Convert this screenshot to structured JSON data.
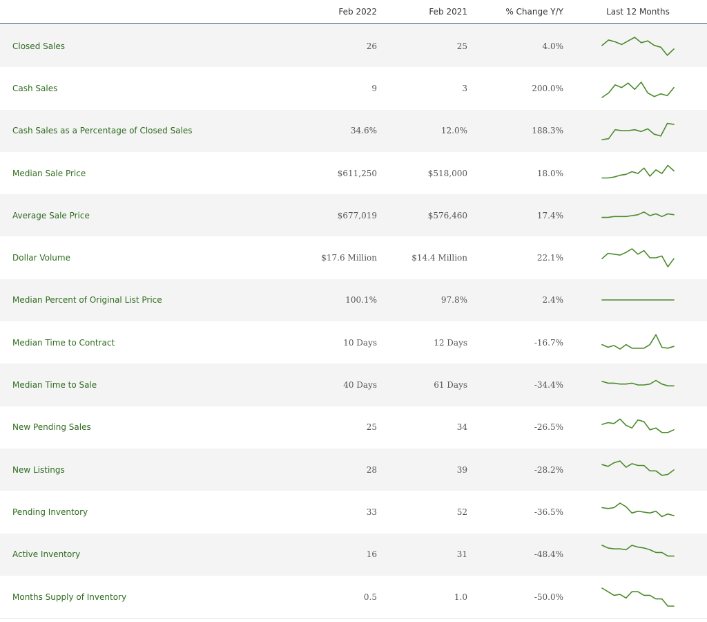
{
  "columns": {
    "feb2022": "Feb 2022",
    "feb2021": "Feb 2021",
    "change": "% Change Y/Y",
    "last12": "Last 12 Months"
  },
  "rows": [
    {
      "label": "Closed Sales",
      "feb2022": "26",
      "feb2021": "25",
      "change": "4.0%",
      "trend": [
        0.55,
        0.85,
        0.75,
        0.6,
        0.8,
        1.0,
        0.7,
        0.8,
        0.55,
        0.45,
        0.0,
        0.35
      ]
    },
    {
      "label": "Cash Sales",
      "feb2022": "9",
      "feb2021": "3",
      "change": "200.0%",
      "trend": [
        0.0,
        0.25,
        0.7,
        0.55,
        0.8,
        0.45,
        0.85,
        0.25,
        0.05,
        0.2,
        0.1,
        0.55
      ]
    },
    {
      "label": "Cash Sales as a Percentage of Closed Sales",
      "feb2022": "34.6%",
      "feb2021": "12.0%",
      "change": "188.3%",
      "trend": [
        0.0,
        0.05,
        0.55,
        0.5,
        0.5,
        0.55,
        0.45,
        0.6,
        0.3,
        0.2,
        0.9,
        0.85
      ]
    },
    {
      "label": "Median Sale Price",
      "feb2022": "$611,250",
      "feb2021": "$518,000",
      "change": "18.0%",
      "trend": [
        0.25,
        0.25,
        0.3,
        0.4,
        0.45,
        0.6,
        0.5,
        0.8,
        0.35,
        0.7,
        0.5,
        0.95,
        0.65
      ]
    },
    {
      "label": "Average Sale Price",
      "feb2022": "$677,019",
      "feb2021": "$576,460",
      "change": "17.4%",
      "trend": [
        0.4,
        0.4,
        0.45,
        0.45,
        0.45,
        0.5,
        0.55,
        0.7,
        0.5,
        0.6,
        0.45,
        0.6,
        0.55
      ]
    },
    {
      "label": "Dollar Volume",
      "feb2022": "$17.6 Million",
      "feb2021": "$14.4 Million",
      "change": "22.1%",
      "trend": [
        0.45,
        0.75,
        0.7,
        0.65,
        0.8,
        1.0,
        0.7,
        0.9,
        0.5,
        0.5,
        0.6,
        0.0,
        0.45
      ]
    },
    {
      "label": "Median Percent of Original List Price",
      "feb2022": "100.1%",
      "feb2021": "97.8%",
      "change": "2.4%",
      "trend": [
        0.5,
        0.5,
        0.5,
        0.5,
        0.5,
        0.5,
        0.5,
        0.5,
        0.5,
        0.5,
        0.5,
        0.5
      ]
    },
    {
      "label": "Median Time to Contract",
      "feb2022": "10 Days",
      "feb2021": "12 Days",
      "change": "-16.7%",
      "trend": [
        0.4,
        0.25,
        0.35,
        0.15,
        0.4,
        0.2,
        0.2,
        0.2,
        0.4,
        0.95,
        0.25,
        0.2,
        0.3
      ]
    },
    {
      "label": "Median Time to Sale",
      "feb2022": "40 Days",
      "feb2021": "61 Days",
      "change": "-34.4%",
      "trend": [
        0.7,
        0.6,
        0.6,
        0.55,
        0.55,
        0.6,
        0.5,
        0.5,
        0.55,
        0.75,
        0.55,
        0.45,
        0.45
      ]
    },
    {
      "label": "New Pending Sales",
      "feb2022": "25",
      "feb2021": "34",
      "change": "-26.5%",
      "trend": [
        0.65,
        0.75,
        0.7,
        0.95,
        0.6,
        0.45,
        0.9,
        0.8,
        0.35,
        0.45,
        0.2,
        0.2,
        0.35
      ]
    },
    {
      "label": "New Listings",
      "feb2022": "28",
      "feb2021": "39",
      "change": "-28.2%",
      "trend": [
        0.8,
        0.7,
        0.9,
        1.0,
        0.65,
        0.85,
        0.75,
        0.75,
        0.45,
        0.45,
        0.2,
        0.25,
        0.5
      ]
    },
    {
      "label": "Pending Inventory",
      "feb2022": "33",
      "feb2021": "52",
      "change": "-36.5%",
      "trend": [
        0.75,
        0.7,
        0.75,
        1.0,
        0.8,
        0.45,
        0.55,
        0.5,
        0.45,
        0.55,
        0.25,
        0.4,
        0.3
      ]
    },
    {
      "label": "Active Inventory",
      "feb2022": "16",
      "feb2021": "31",
      "change": "-48.4%",
      "trend": [
        1.0,
        0.85,
        0.8,
        0.8,
        0.75,
        1.0,
        0.9,
        0.85,
        0.75,
        0.6,
        0.6,
        0.4,
        0.4
      ]
    },
    {
      "label": "Months Supply of Inventory",
      "feb2022": "0.5",
      "feb2021": "1.0",
      "change": "-50.0%",
      "trend": [
        1.0,
        0.8,
        0.6,
        0.65,
        0.45,
        0.8,
        0.8,
        0.6,
        0.6,
        0.4,
        0.4,
        0.0,
        0.0
      ]
    }
  ],
  "colors": {
    "label": "#2e6b1e",
    "spark": "#4a8a2a",
    "header_rule": "#1f3a5a",
    "stripe": "#f4f4f4"
  }
}
